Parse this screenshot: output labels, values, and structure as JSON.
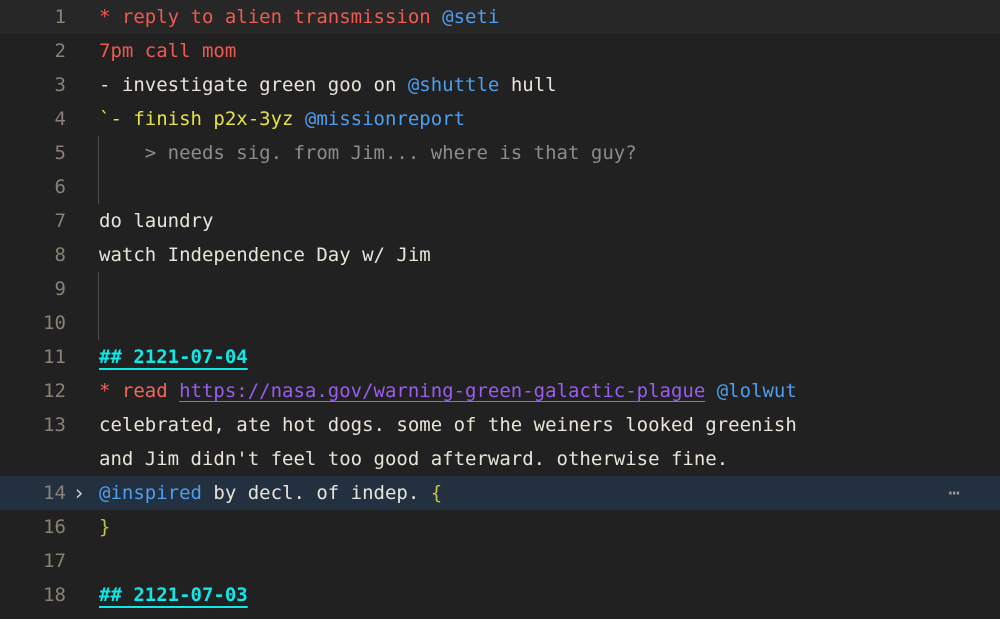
{
  "editor": {
    "background": "#212121",
    "gutter_color": "#888277",
    "current_line_bg": "#272727",
    "selected_line_bg": "#22303f",
    "fold_marker": "⋯",
    "fold_chevron": "›"
  },
  "lines": [
    {
      "number": "1",
      "state": "current",
      "indent_guide": false,
      "fold": "",
      "tokens": [
        {
          "text": "* reply to alien transmission ",
          "style": "t-red"
        },
        {
          "text": "@seti",
          "style": "t-blue"
        }
      ]
    },
    {
      "number": "2",
      "state": "normal",
      "indent_guide": false,
      "fold": "",
      "tokens": [
        {
          "text": "7pm call mom",
          "style": "t-red"
        }
      ]
    },
    {
      "number": "3",
      "state": "normal",
      "indent_guide": false,
      "fold": "",
      "tokens": [
        {
          "text": "- investigate green goo on ",
          "style": "t-white"
        },
        {
          "text": "@shuttle",
          "style": "t-blue"
        },
        {
          "text": " hull",
          "style": "t-white"
        }
      ]
    },
    {
      "number": "4",
      "state": "normal",
      "indent_guide": false,
      "fold": "",
      "tokens": [
        {
          "text": "`- finish p2x-3yz ",
          "style": "t-yellow"
        },
        {
          "text": "@missionreport",
          "style": "t-blue"
        }
      ]
    },
    {
      "number": "5",
      "state": "normal",
      "indent_guide": true,
      "fold": "",
      "tokens": [
        {
          "text": "    > needs sig. from Jim... where is that guy?",
          "style": "t-grey"
        }
      ]
    },
    {
      "number": "6",
      "state": "normal",
      "indent_guide": true,
      "fold": "",
      "tokens": [
        {
          "text": "",
          "style": "t-white"
        }
      ]
    },
    {
      "number": "7",
      "state": "normal",
      "indent_guide": false,
      "fold": "",
      "tokens": [
        {
          "text": "do laundry",
          "style": "t-white"
        }
      ]
    },
    {
      "number": "8",
      "state": "normal",
      "indent_guide": false,
      "fold": "",
      "tokens": [
        {
          "text": "watch Independence Day w/ Jim",
          "style": "t-white"
        }
      ]
    },
    {
      "number": "9",
      "state": "normal",
      "indent_guide": true,
      "fold": "",
      "tokens": [
        {
          "text": "",
          "style": "t-white"
        }
      ]
    },
    {
      "number": "10",
      "state": "normal",
      "indent_guide": true,
      "fold": "",
      "tokens": [
        {
          "text": "",
          "style": "t-white"
        }
      ]
    },
    {
      "number": "11",
      "state": "normal",
      "indent_guide": false,
      "fold": "",
      "tokens": [
        {
          "text": "## 2121-07-04",
          "style": "t-cyan"
        }
      ]
    },
    {
      "number": "12",
      "state": "normal",
      "indent_guide": false,
      "fold": "",
      "tokens": [
        {
          "text": "* read ",
          "style": "t-salmon"
        },
        {
          "text": "https://nasa.gov/warning-green-galactic-plague",
          "style": "t-purple"
        },
        {
          "text": " ",
          "style": "t-white"
        },
        {
          "text": "@lolwut",
          "style": "t-blue"
        }
      ]
    },
    {
      "number": "13",
      "state": "normal",
      "indent_guide": false,
      "fold": "",
      "tokens": [
        {
          "text": "celebrated, ate hot dogs. some of the weiners looked greenish",
          "style": "t-white"
        }
      ]
    },
    {
      "number": "",
      "state": "normal",
      "indent_guide": false,
      "fold": "",
      "tokens": [
        {
          "text": "and Jim didn't feel too good afterward. otherwise fine.",
          "style": "t-white"
        }
      ]
    },
    {
      "number": "14",
      "state": "selected",
      "indent_guide": false,
      "fold": "chevron",
      "fold_marker": true,
      "tokens": [
        {
          "text": "@inspired",
          "style": "t-blue"
        },
        {
          "text": " by decl. of indep. ",
          "style": "t-white"
        },
        {
          "text": "{",
          "style": "t-brace"
        }
      ]
    },
    {
      "number": "16",
      "state": "normal",
      "indent_guide": false,
      "fold": "",
      "tokens": [
        {
          "text": "}",
          "style": "t-brace"
        }
      ]
    },
    {
      "number": "17",
      "state": "normal",
      "indent_guide": false,
      "fold": "",
      "tokens": [
        {
          "text": "",
          "style": "t-white"
        }
      ]
    },
    {
      "number": "18",
      "state": "normal",
      "indent_guide": false,
      "fold": "",
      "tokens": [
        {
          "text": "## 2121-07-03",
          "style": "t-cyan"
        }
      ]
    }
  ]
}
